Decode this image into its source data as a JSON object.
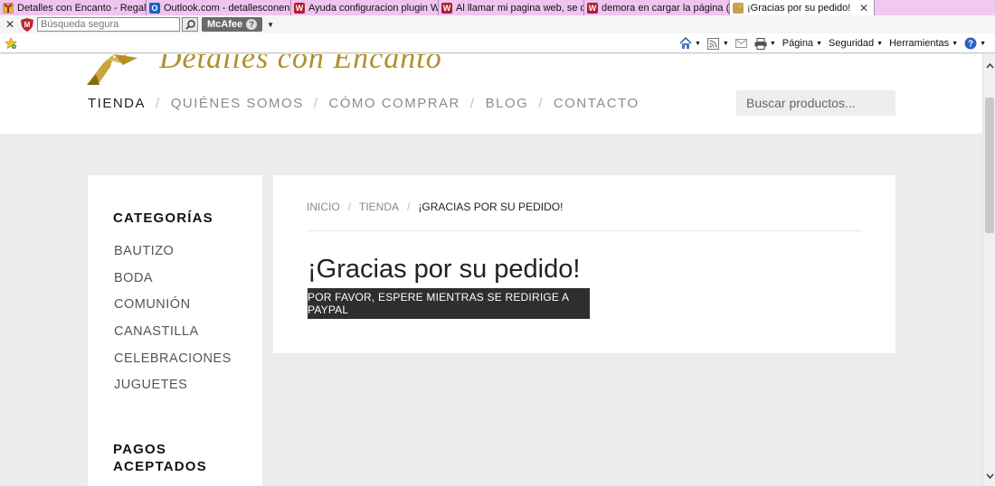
{
  "browser": {
    "tabs": [
      {
        "title": "Detalles con Encanto - Regalos...",
        "icon": "gift-icon"
      },
      {
        "title": "Outlook.com - detallesconenc...",
        "icon": "outlook-icon"
      },
      {
        "title": "Ayuda configuracion plugin W...",
        "icon": "woocommerce-icon"
      },
      {
        "title": "Al llamar mi pagina web, se de...",
        "icon": "woocommerce-icon"
      },
      {
        "title": "demora en cargar la página (1/...",
        "icon": "woocommerce-icon"
      },
      {
        "title": "¡Gracias por su pedido!",
        "icon": "gift-icon"
      }
    ],
    "toolbar": {
      "close_glyph": "✕",
      "search_placeholder": "Búsqueda segura",
      "mcafee_label": "McAfee",
      "mcafee_help": "?",
      "page_menu": "Página",
      "security_menu": "Seguridad",
      "tools_menu": "Herramientas",
      "help_glyph": "?"
    }
  },
  "site": {
    "logo_text": "Detalles con Encanto",
    "nav": [
      {
        "label": "TIENDA",
        "active": true
      },
      {
        "label": "QUIÉNES SOMOS",
        "active": false
      },
      {
        "label": "CÓMO COMPRAR",
        "active": false
      },
      {
        "label": "BLOG",
        "active": false
      },
      {
        "label": "CONTACTO",
        "active": false
      }
    ],
    "nav_separator": "/",
    "search_placeholder": "Buscar productos...",
    "sidebar": {
      "categories_title": "CATEGORÍAS",
      "categories": [
        "BAUTIZO",
        "BODA",
        "COMUNIÓN",
        "CANASTILLA",
        "CELEBRACIONES",
        "JUGUETES"
      ],
      "payments_title_line1": "PAGOS",
      "payments_title_line2": "ACEPTADOS"
    },
    "breadcrumb": {
      "home": "INICIO",
      "shop": "TIENDA",
      "current": "¡GRACIAS POR SU PEDIDO!",
      "separator": "/"
    },
    "page_title": "¡Gracias por su pedido!",
    "paypal_message": "POR FAVOR, ESPERE MIENTRAS SE REDIRIGE A PAYPAL"
  },
  "colors": {
    "tabbar_bg": "#f1c8f1",
    "page_bg": "#ececec",
    "logo_gold": "#b0902a",
    "button_dark": "#2e2e2e"
  }
}
